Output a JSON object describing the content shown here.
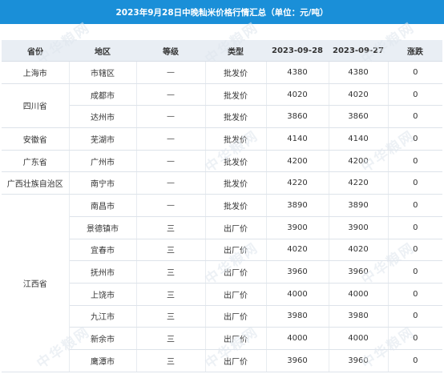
{
  "title": "2023年9月28日中晚籼米价格行情汇总（单位：元/吨）",
  "watermark": "中华粮网",
  "colors": {
    "title_bg": "#1a8fd8",
    "header_bg": "#e9eef4"
  },
  "columns": [
    "省份",
    "地区",
    "等级",
    "类型",
    "2023-09-28",
    "2023-09-27",
    "涨跌"
  ],
  "province_groups": [
    {
      "name": "上海市",
      "rows": [
        [
          "市辖区",
          "—",
          "批发价",
          "4380",
          "4380",
          "0"
        ]
      ]
    },
    {
      "name": "四川省",
      "rows": [
        [
          "成都市",
          "—",
          "批发价",
          "4020",
          "4020",
          "0"
        ],
        [
          "达州市",
          "—",
          "批发价",
          "3860",
          "3860",
          "0"
        ]
      ]
    },
    {
      "name": "安徽省",
      "rows": [
        [
          "芜湖市",
          "—",
          "批发价",
          "4140",
          "4140",
          "0"
        ]
      ]
    },
    {
      "name": "广东省",
      "rows": [
        [
          "广州市",
          "—",
          "批发价",
          "4200",
          "4200",
          "0"
        ]
      ]
    },
    {
      "name": "广西壮族自治区",
      "rows": [
        [
          "南宁市",
          "—",
          "批发价",
          "4220",
          "4220",
          "0"
        ]
      ]
    },
    {
      "name": "江西省",
      "rows": [
        [
          "南昌市",
          "—",
          "批发价",
          "3890",
          "3890",
          "0"
        ],
        [
          "景德镇市",
          "三",
          "出厂价",
          "3900",
          "3900",
          "0"
        ],
        [
          "宜春市",
          "三",
          "出厂价",
          "4020",
          "4020",
          "0"
        ],
        [
          "抚州市",
          "三",
          "出厂价",
          "3960",
          "3960",
          "0"
        ],
        [
          "上饶市",
          "三",
          "出厂价",
          "4000",
          "4000",
          "0"
        ],
        [
          "九江市",
          "三",
          "出厂价",
          "3980",
          "3980",
          "0"
        ],
        [
          "新余市",
          "三",
          "出厂价",
          "4000",
          "4000",
          "0"
        ],
        [
          "鹰潭市",
          "三",
          "出厂价",
          "3960",
          "3960",
          "0"
        ]
      ]
    }
  ]
}
